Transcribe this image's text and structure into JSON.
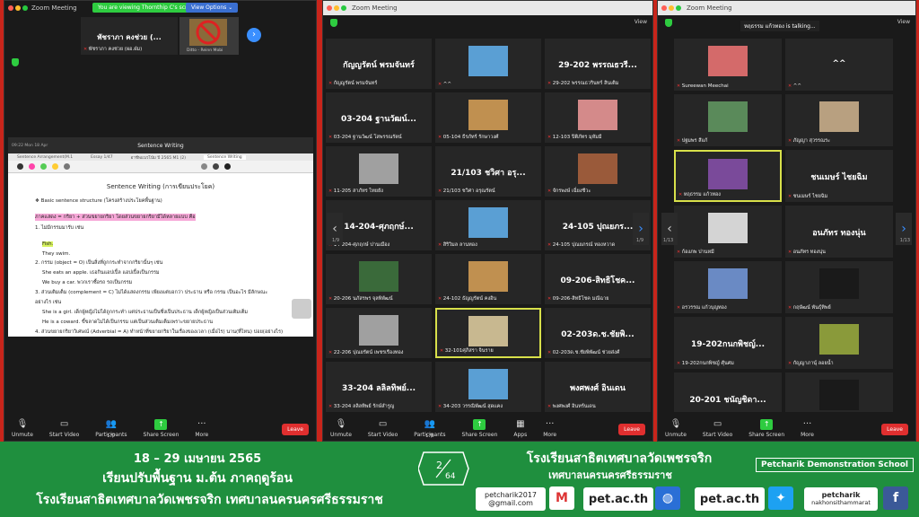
{
  "window1": {
    "title": "Zoom Meeting",
    "share_banner": "You are viewing Thornthip C's screen",
    "view_options": "View Options ⌄",
    "tile1_big": "พัชราภา คงช่วย (...",
    "tile1_name": "พัชราภา คงช่วย (ผอ.ฝ่ม)",
    "tile2_caption": "Ditto - Reinn Mobi",
    "doc_app_title": "Sentence Writing",
    "doc_status": "09:22  Mon 18 Apr",
    "doc_tabs": [
      "Sentence Arrangement(M.1",
      "Essay 1/47",
      "อาชีพแนวโน้ม ปี 2565 M1 (2)",
      "Sentence Writing"
    ],
    "doc_heading": "Sentence Writing (การเขียนประโยค)",
    "doc_lines": [
      "❖  Basic sentence structure (โครงสร้างประโยคพื้นฐาน)",
      "ภาคแสดง = กริยา + ส่วนขยายกริยา โดยส่วนขยายกริยามีได้หลายแบบ คือ",
      "1. ไม่มีกรรมมารับ เช่น",
      "Fish.",
      "They swim.",
      "2. กรรม (object = O) เป็นสิ่งที่ถูกกระทำจากกริยานั้นๆ เช่น",
      "She eats an apple.            เธอกินแอปเปิ้ล   แอปเปิ้ลเป็นกรรม",
      "We buy a car.                     พวกเราซื้อรถ  รถเป็นกรรม",
      "3. ส่วนเติมเต็ม (complement = C) ไม่ได้แสดงกรรม เพียงแต่บอกว่า ประธาน หรือ กรรม เป็นอะไร มีลักษณะ",
      "อย่างไร เช่น",
      "She is a girl.                   เด็กผู้หญิงไม่ได้ถูกกระทำ แต่ประธานเป็นซึ่งเป็นประธาน เด็กผู้หญิงเป็นส่วนเติมเต็ม",
      "He is a coward.               ขี้ขลาดไม่ได้เป็นกรรม แต่เป็นส่วนเติมเต็มเพราะขยายประธาน",
      "4. ส่วนขยายกริยาวิเศษณ์ (Adverbial = A) ทำหน้าที่ขยายกริยาในเรื่องของเวลา (เมื่อไร) นาน(ที่ไหน) บ่อย(อย่างไร)"
    ],
    "toolbar": {
      "unmute": "Unmute",
      "start_video": "Start Video",
      "participants": "Participants",
      "participants_count": "177",
      "share": "Share Screen",
      "more": "More",
      "leave": "Leave"
    }
  },
  "window2": {
    "title": "Zoom Meeting",
    "view": "View",
    "page": "1/9",
    "page_right": "1/9",
    "tiles": [
      {
        "big": "กัญญรัตน์ พรมจันทร์",
        "name": "กัญญรัตน์ พรมจันทร์"
      },
      {
        "big": "",
        "name": "^^",
        "caption": "Ditto - Reinn Mobi"
      },
      {
        "big": "29-202 พรรณธวรี...",
        "name": "29-202 พรรณธวรินทร์ สินเติม"
      },
      {
        "big": "03-204 ฐานวัฒน์...",
        "name": "03-204 ฐานวัฒน์ โสพรรณรัตน์"
      },
      {
        "big": "",
        "name": "05-104 ธีรภัทร์ รักษาวงศ์"
      },
      {
        "big": "",
        "name": "12-103 ปิติภัทร มุหัมมี"
      },
      {
        "big": "",
        "name": "11-205 สาภัทร ไทยยัง"
      },
      {
        "big": "21/103 ชวิศา อรุ...",
        "name": "21/103 ชวิศา อรุณรัตน์"
      },
      {
        "big": "",
        "name": "จักรพงษ์ เฉี่ยงชีวะ"
      },
      {
        "big": "14-204-ศุภฤกษ์...",
        "name": "14-204-ศุภฤกษ์ ปานเมือง"
      },
      {
        "big": "",
        "name": "สิริวิมล ลานทอง"
      },
      {
        "big": "24-105 ปุณยภร...",
        "name": "24-105 ปุณยภรณ์ ทองหวาด"
      },
      {
        "big": "",
        "name": "20-206 นภัสรพร จุลพิพัฒน์"
      },
      {
        "big": "",
        "name": "24-102 ธัญญรัตน์ คงอิน"
      },
      {
        "big": "09-206-สิทธิโชค...",
        "name": "09-206-สิทธิโชค มณีฉาย"
      },
      {
        "big": "",
        "name": "22-206 ปุณยรัตน์ เพชรเรืองทอง"
      },
      {
        "big": "",
        "name": "32-101ศุภิสรา จินราย"
      },
      {
        "big": "02-203ด.ช.ชัยพิ...",
        "name": "02-203ด.ช.ชัยพิพัฒน์ ช่วยส่งศ์"
      },
      {
        "big": "33-204 ลลิลทิพย์...",
        "name": "33-204 ลลิลทิพย์ รักษ์สำรูญ"
      },
      {
        "big": "",
        "name": "34-203 วรรณิพัฒน์ สุดแคง"
      },
      {
        "big": "พงศพงศ์ อินเดน",
        "name": "พงศพงศ์ อินทร์นเดน"
      }
    ],
    "toolbar": {
      "unmute": "Unmute",
      "start_video": "Start Video",
      "participants": "Participants",
      "participants_count": "175",
      "share": "Share Screen",
      "apps": "Apps",
      "more": "More",
      "leave": "Leave"
    }
  },
  "window3": {
    "title": "Zoom Meeting",
    "talking": "หฤธรรม แก้วทอง is talking...",
    "view": "View",
    "page_left": "1/13",
    "page_right": "1/13",
    "tiles": [
      {
        "big": "",
        "name": "Sureewan Meechai"
      },
      {
        "big": "^^",
        "name": "^^"
      },
      {
        "big": "",
        "name": "ปฐมพร สีแก้"
      },
      {
        "big": "",
        "name": "ภัญญา สุวรรณระ"
      },
      {
        "big": "",
        "name": "หฤธรรม แก้วทอง"
      },
      {
        "big": "ชนเมษร์ ไชยฉิม",
        "name": "ชนเมษร์ ไชยฉิม"
      },
      {
        "big": "",
        "name": "ก้องภพ ปานหมี"
      },
      {
        "big": "อนภัทร ทองนุ่น",
        "name": "อนภัทร ทองนุ่น"
      },
      {
        "big": "",
        "name": "อรวรรณ แก้วบุญทอง"
      },
      {
        "big": "",
        "name": "กฤษัฒน์ พันธุ์ทิพย์"
      },
      {
        "big": "19-202กนกพิชญ์...",
        "name": "19-202กนกพิชญ์ ศุ้นศม"
      },
      {
        "big": "",
        "name": "กัญญาภานุ์ ลอยน้ำ"
      },
      {
        "big": "20-201 ชนัญชิดา...",
        "name": "20-201 ชนัญชิดา พ้นทรัพย์"
      },
      {
        "big": "",
        "name": "ฐิติวัฒน์ ถือรอดพร"
      }
    ],
    "toolbar": {
      "unmute": "Unmute",
      "start_video": "Start Video",
      "share": "Share Screen",
      "more": "More",
      "leave": "Leave"
    }
  },
  "footer": {
    "date": "18 – 29 เมษายน 2565",
    "course": "เรียนปรับพื้นฐาน ม.ต้น ภาคฤดูร้อน",
    "school_full": "โรงเรียนสาธิตเทศบาลวัดเพชรจริก เทศบาลนครนครศรีธรรมราช",
    "page": "2",
    "page_year": "64",
    "school_name": "โรงเรียนสาธิตเทศบาลวัดเพชรจริก",
    "municipality": "เทศบาลนครนครศรีธรรมราช",
    "school_en": "Petcharik Demonstration School",
    "email_user": "petcharik2017",
    "email_domain": "@gmail.com",
    "web1": "pet.ac.th",
    "web2": "pet.ac.th",
    "fb_name": "petcharik",
    "fb_sub": "nakhonsithammarat"
  },
  "colors": {
    "footer_green": "#1f8f3e",
    "frame_red": "#c8251b",
    "zoom_green": "#2ecc40",
    "highlight": "#d8e04a"
  }
}
